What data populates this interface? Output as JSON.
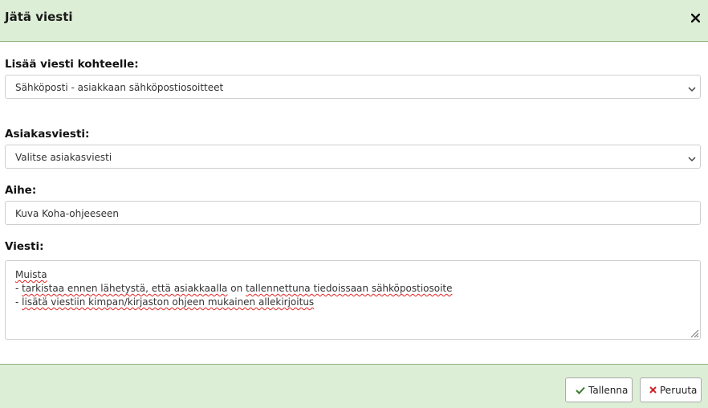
{
  "dialog": {
    "title": "Jätä viesti",
    "close_icon": "close-icon"
  },
  "form": {
    "destination": {
      "label": "Lisää viesti kohteelle:",
      "selected": "Sähköposti - asiakkaan sähköpostiosoitteet"
    },
    "template": {
      "label": "Asiakasviesti:",
      "selected": "Valitse asiakasviesti"
    },
    "subject": {
      "label": "Aihe:",
      "value": "Kuva Koha-ohjeeseen"
    },
    "message": {
      "label": "Viesti:",
      "lines": [
        [
          {
            "text": "Muista",
            "misspelled": true
          }
        ],
        [
          {
            "text": "- ",
            "misspelled": false
          },
          {
            "text": "tarkistaa ennen lähetystä, että asiakkaalla",
            "misspelled": true
          },
          {
            "text": " on ",
            "misspelled": false
          },
          {
            "text": "tallennettuna tiedoissaan sähköpostiosoite",
            "misspelled": true
          }
        ],
        [
          {
            "text": "- ",
            "misspelled": false
          },
          {
            "text": "lisätä viestiin kimpan/kirjaston ohjeen mukainen allekirjoitus",
            "misspelled": true
          }
        ]
      ]
    }
  },
  "footer": {
    "save_label": "Tallenna",
    "cancel_label": "Peruuta",
    "save_icon": "check-icon",
    "cancel_icon": "x-icon"
  },
  "colors": {
    "header_bg": "#ddeed6",
    "header_border": "#8ab37a",
    "check_green": "#3a7a2a",
    "cancel_red": "#cc2222",
    "spell_underline": "#e02020"
  }
}
